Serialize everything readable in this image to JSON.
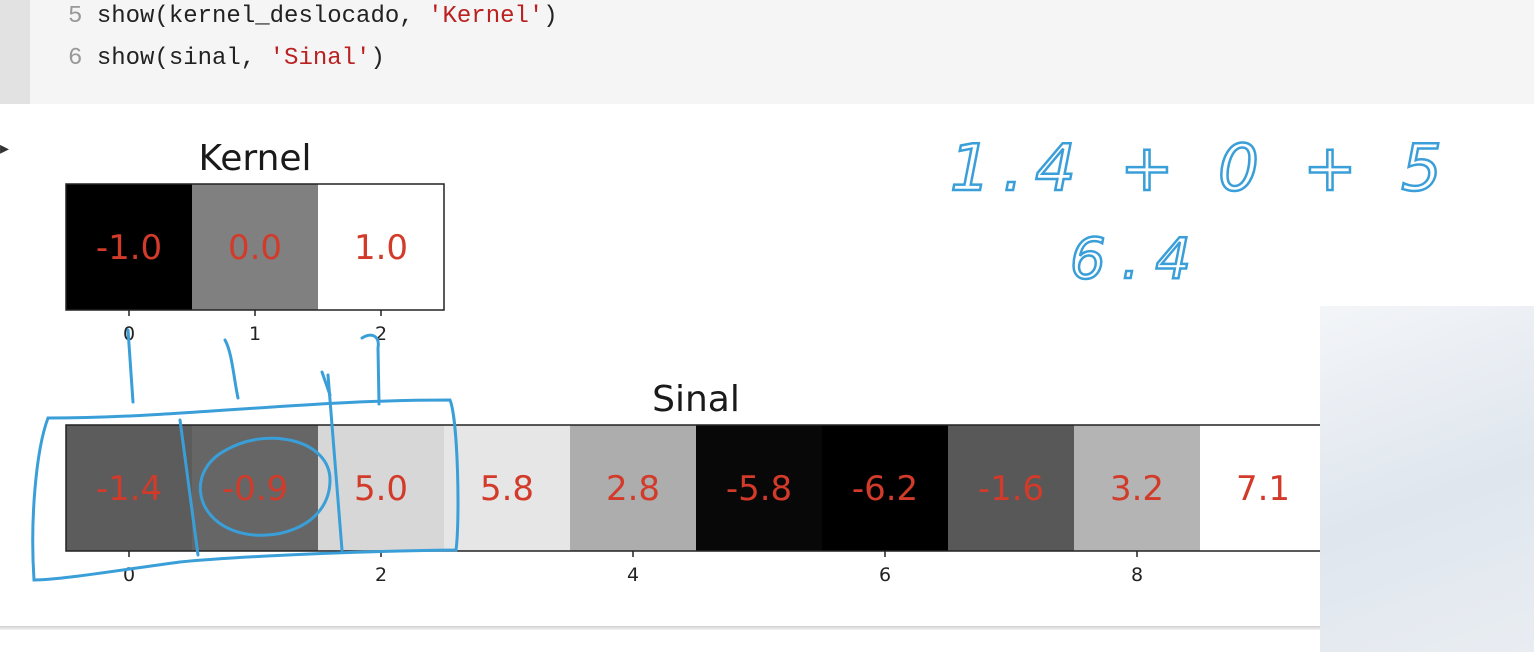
{
  "code": {
    "lines": [
      {
        "num": "5",
        "pre": "show(kernel_deslocado, ",
        "str": "'Kernel'",
        "post": ")"
      },
      {
        "num": "6",
        "pre": "show(sinal, ",
        "str": "'Sinal'",
        "post": ")"
      }
    ]
  },
  "chart_data": [
    {
      "type": "heatmap",
      "title": "Kernel",
      "x_ticks": [
        "0",
        "1",
        "2"
      ],
      "values": [
        -1.0,
        0.0,
        1.0
      ],
      "labels": [
        "-1.0",
        "0.0",
        "1.0"
      ],
      "colormap": "gray",
      "label_color": "#d23a2a"
    },
    {
      "type": "heatmap",
      "title": "Sinal",
      "x_ticks": [
        "0",
        "2",
        "4",
        "6",
        "8"
      ],
      "values": [
        -1.4,
        -0.9,
        5.0,
        5.8,
        2.8,
        -5.8,
        -6.2,
        -1.6,
        3.2,
        7.1
      ],
      "labels": [
        "-1.4",
        "-0.9",
        "5.0",
        "5.8",
        "2.8",
        "-5.8",
        "-6.2",
        "-1.6",
        "3.2",
        "7.1"
      ],
      "colormap": "gray",
      "label_color": "#d23a2a"
    }
  ],
  "annotations": {
    "color": "#3a9fd8",
    "line1": "1.4 + 0 + 5",
    "line2": "6.4"
  }
}
